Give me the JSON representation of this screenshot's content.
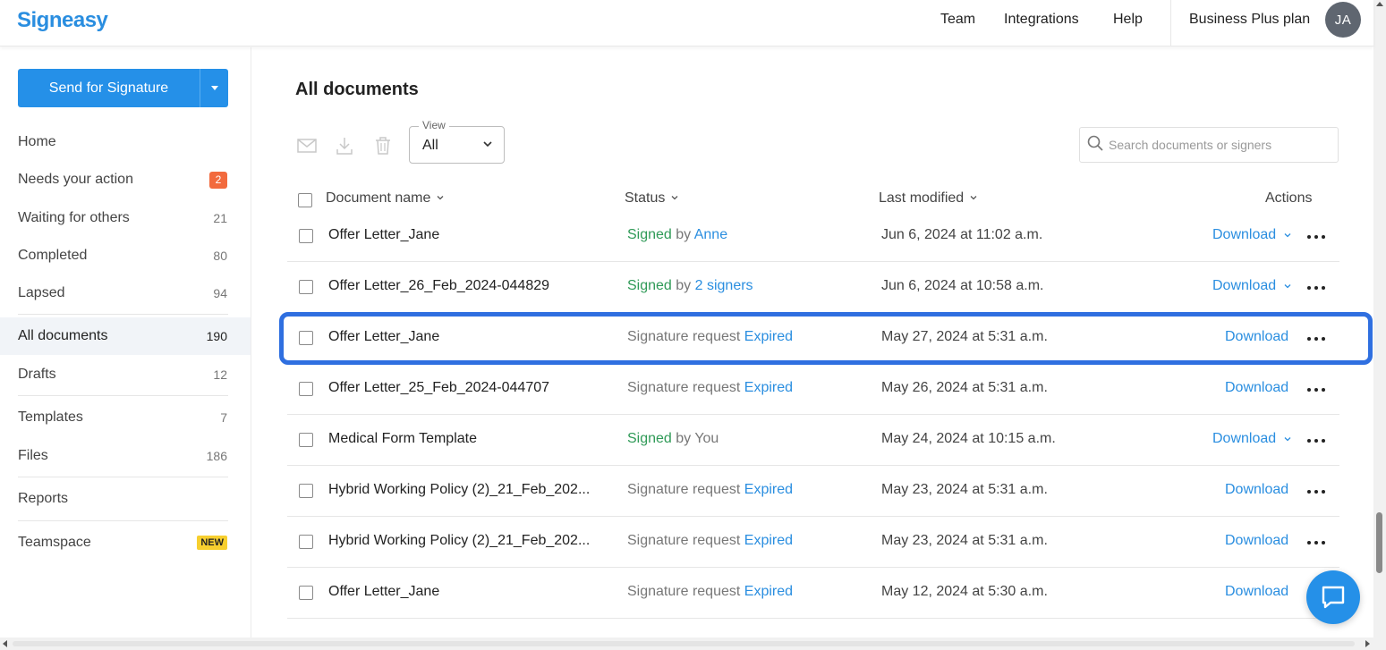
{
  "header": {
    "logo": "Signeasy",
    "nav": [
      "Team",
      "Integrations",
      "Help"
    ],
    "plan": "Business Plus plan",
    "avatar_initials": "JA"
  },
  "sidebar": {
    "send_button": "Send for Signature",
    "items": [
      {
        "label": "Home",
        "count": ""
      },
      {
        "label": "Needs your action",
        "count": "2"
      },
      {
        "label": "Waiting for others",
        "count": "21"
      },
      {
        "label": "Completed",
        "count": "80"
      },
      {
        "label": "Lapsed",
        "count": "94"
      },
      {
        "label": "All documents",
        "count": "190"
      },
      {
        "label": "Drafts",
        "count": "12"
      },
      {
        "label": "Templates",
        "count": "7"
      },
      {
        "label": "Files",
        "count": "186"
      },
      {
        "label": "Reports",
        "count": ""
      },
      {
        "label": "Teamspace",
        "count": "NEW"
      }
    ]
  },
  "main": {
    "title": "All documents",
    "view": {
      "legend": "View",
      "value": "All"
    },
    "search_placeholder": "Search documents or signers",
    "columns": {
      "name": "Document name",
      "status": "Status",
      "modified": "Last modified",
      "actions": "Actions"
    },
    "rows": [
      {
        "name": "Offer Letter_Jane",
        "status_main": "Signed",
        "status_mid": " by ",
        "status_link": "Anne",
        "modified": "Jun 6, 2024 at 11:02 a.m.",
        "download": "Download",
        "has_menu": true
      },
      {
        "name": "Offer Letter_26_Feb_2024-044829",
        "status_main": "Signed",
        "status_mid": " by ",
        "status_link": "2 signers",
        "modified": "Jun 6, 2024 at 10:58 a.m.",
        "download": "Download",
        "has_menu": true
      },
      {
        "name": "Offer Letter_Jane",
        "status_main": "Signature request",
        "status_mid": " ",
        "status_link": "Expired",
        "modified": "May 27, 2024 at 5:31 a.m.",
        "download": "Download",
        "has_menu": false
      },
      {
        "name": "Offer Letter_25_Feb_2024-044707",
        "status_main": "Signature request",
        "status_mid": " ",
        "status_link": "Expired",
        "modified": "May 26, 2024 at 5:31 a.m.",
        "download": "Download",
        "has_menu": false
      },
      {
        "name": "Medical Form Template",
        "status_main": "Signed",
        "status_mid": " by ",
        "status_link": "You",
        "modified": "May 24, 2024 at 10:15 a.m.",
        "download": "Download",
        "has_menu": true
      },
      {
        "name": "Hybrid Working Policy (2)_21_Feb_202...",
        "status_main": "Signature request",
        "status_mid": " ",
        "status_link": "Expired",
        "modified": "May 23, 2024 at 5:31 a.m.",
        "download": "Download",
        "has_menu": false
      },
      {
        "name": "Hybrid Working Policy (2)_21_Feb_202...",
        "status_main": "Signature request",
        "status_mid": " ",
        "status_link": "Expired",
        "modified": "May 23, 2024 at 5:31 a.m.",
        "download": "Download",
        "has_menu": false
      },
      {
        "name": "Offer Letter_Jane",
        "status_main": "Signature request",
        "status_mid": " ",
        "status_link": "Expired",
        "modified": "May 12, 2024 at 5:30 a.m.",
        "download": "Download",
        "has_menu": false
      }
    ]
  },
  "colors": {
    "brand": "#2a8ee0",
    "signed_green": "#2f9a57",
    "highlight": "#2f6fe0",
    "badge_orange": "#f26a3d",
    "badge_new": "#f7cf2f"
  }
}
